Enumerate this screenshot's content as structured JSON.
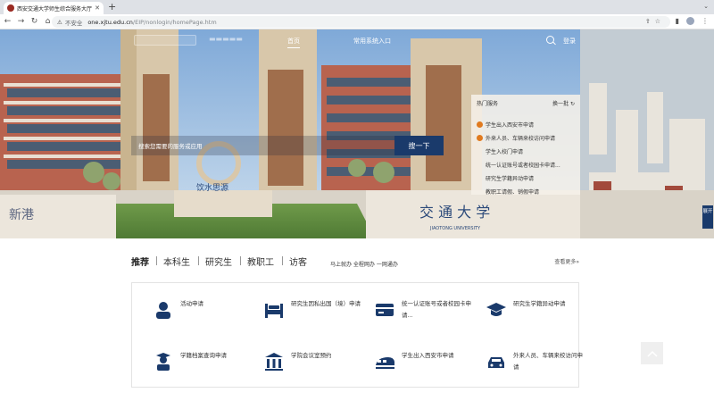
{
  "browser": {
    "tab_title": "西安交通大学师生综合服务大厅",
    "new_tab": "+",
    "insecure_label": "不安全",
    "url_host": "one.xjtu.edu.cn",
    "url_path": "/EIP/nonlogin/homePage.htm"
  },
  "nav": {
    "home": "首页",
    "common_systems": "常用系统入口",
    "login": "登录"
  },
  "search": {
    "placeholder": "搜索您需要的服务或应用",
    "button": "搜一下"
  },
  "hot": {
    "title": "热门服务",
    "refresh": "换一批",
    "items": [
      {
        "label": "学生出入西安市申请",
        "icon": "fire-icon"
      },
      {
        "label": "外来人员、车辆来校访问申请",
        "icon": "fire-icon"
      },
      {
        "label": "学生入校门申请",
        "icon": ""
      },
      {
        "label": "统一认证账号或者校园卡申请...",
        "icon": ""
      },
      {
        "label": "研究生学籍异动申请",
        "icon": ""
      },
      {
        "label": "教职工请假、销假申请",
        "icon": ""
      }
    ]
  },
  "side": {
    "label": "展开"
  },
  "categories": {
    "items": [
      "推荐",
      "本科生",
      "研究生",
      "教职工",
      "访客"
    ],
    "slogan": "马上就办 全程网办 一网通办",
    "more": "查看更多»"
  },
  "services": [
    {
      "label": "活动申请",
      "icon": "person-icon"
    },
    {
      "label": "研究生因私出国（境）申请",
      "icon": "bed-icon"
    },
    {
      "label": "统一认证账号或者校园卡申请...",
      "icon": "card-icon"
    },
    {
      "label": "研究生学籍异动申请",
      "icon": "graduation-cap-icon"
    },
    {
      "label": "学籍档案查询申请",
      "icon": "graduate-icon"
    },
    {
      "label": "学院会议室预约",
      "icon": "building-icon"
    },
    {
      "label": "学生出入西安市申请",
      "icon": "train-icon"
    },
    {
      "label": "外来人员、车辆来校访问申请",
      "icon": "car-icon"
    }
  ],
  "colors": {
    "brand": "#1a3a6b",
    "accent_hot": "#e07a1f"
  }
}
